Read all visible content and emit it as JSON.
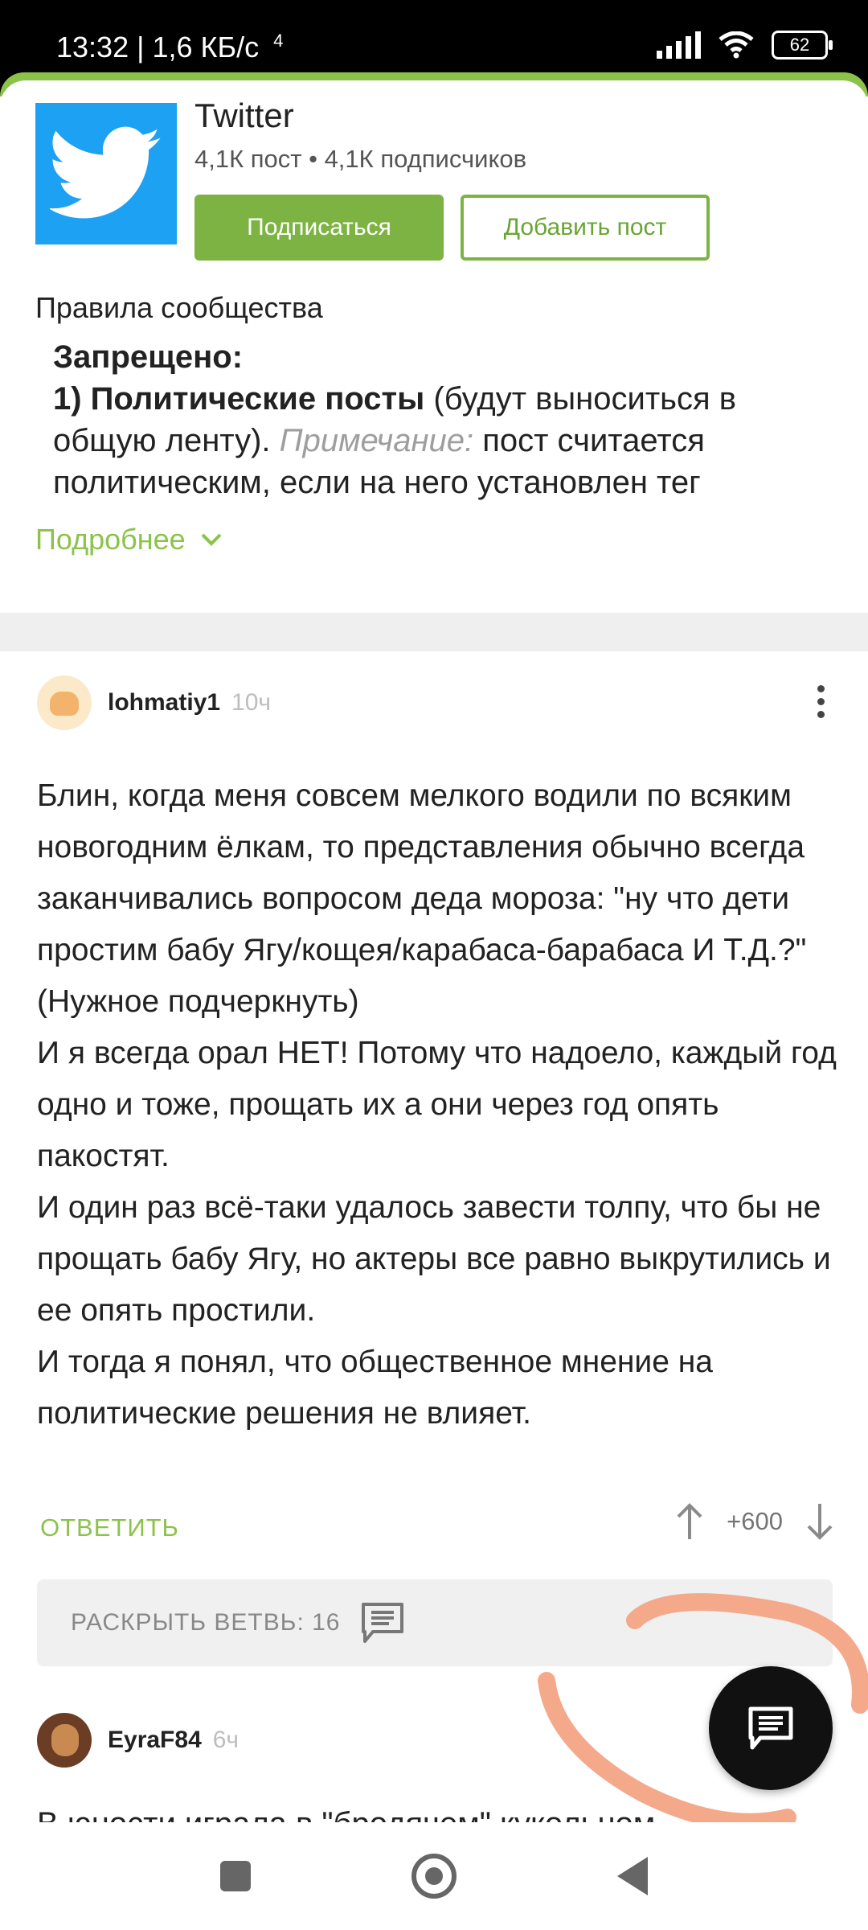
{
  "status_bar": {
    "left_text": "13:32 | 1,6 КБ/с",
    "data_icon": "4",
    "battery": "62"
  },
  "community": {
    "title": "Twitter",
    "stats": "4,1К пост • 4,1К подписчиков",
    "subscribe_label": "Подписаться",
    "add_post_label": "Добавить пост",
    "rules_title": "Правила сообщества",
    "rules_heading": "Запрещено:",
    "rules_item_bold": "1) Политические посты",
    "rules_item_rest": " (будут выноситься в общую ленту). ",
    "rules_note_label": "Примечание:",
    "rules_note_text": " пост считается политическим, если на него установлен тег",
    "more_label": "Подробнее"
  },
  "comment": {
    "username": "lohmatiy1",
    "time": "10ч",
    "paragraphs": [
      "Блин, когда меня совсем мелкого водили по всяким новогодним ёлкам, то представления обычно всегда заканчивались вопросом деда мороза: \"ну что дети простим бабу Ягу/кощея/карабаса-барабаса И Т.Д.?\" (Нужное подчеркнуть)",
      "И я всегда орал НЕТ! Потому что надоело, каждый год одно и тоже, прощать их а они через год опять пакостят.",
      "И один раз всё-таки удалось завести толпу, что бы не прощать бабу Ягу, но актеры все равно выкрутились и ее опять простили.",
      "И тогда я понял, что общественное мнение на политические решения не влияет."
    ],
    "reply_label": "ОТВЕТИТЬ",
    "rating": "+600",
    "branch_label": "РАСКРЫТЬ ВЕТВЬ: 16"
  },
  "comment2": {
    "username": "EyraF84",
    "time": "6ч",
    "preview": "В юности играла в \"бродячем\" кукольном"
  },
  "colors": {
    "accent": "#8bc34a",
    "twitter": "#1da1f2",
    "scribble": "#f4a98a"
  },
  "icons": {
    "logo": "twitter-bird-icon",
    "more": "chevron-down-icon",
    "menu": "more-vertical-icon",
    "upvote": "arrow-up-icon",
    "downvote": "arrow-down-icon",
    "branch": "comment-icon",
    "fab": "comment-icon"
  }
}
